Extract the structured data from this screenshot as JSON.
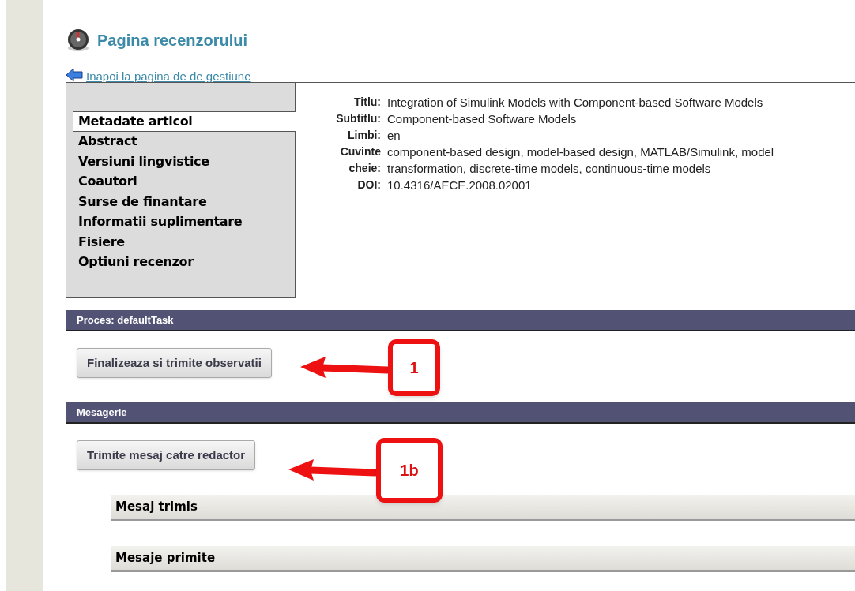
{
  "page_title": "Pagina recenzorului",
  "back_link": "Inapoi la pagina de de gestiune",
  "sidebar": {
    "items": [
      {
        "label": "Metadate articol",
        "selected": true
      },
      {
        "label": "Abstract",
        "selected": false
      },
      {
        "label": "Versiuni lingvistice",
        "selected": false
      },
      {
        "label": "Coautori",
        "selected": false
      },
      {
        "label": "Surse de finantare",
        "selected": false
      },
      {
        "label": "Informatii suplimentare",
        "selected": false
      },
      {
        "label": "Fisiere",
        "selected": false
      },
      {
        "label": "Optiuni recenzor",
        "selected": false
      }
    ]
  },
  "metadata": [
    {
      "label": "Titlu:",
      "value": "Integration of Simulink Models with Component-based Software Models"
    },
    {
      "label": "Subtitlu:",
      "value": "Component-based Software Models"
    },
    {
      "label": "Limbi:",
      "value": "en"
    },
    {
      "label": "Cuvinte cheie:",
      "value": "component-based design, model-based design, MATLAB/Simulink, model transformation, discrete-time models, continuous-time models"
    },
    {
      "label": "DOI:",
      "value": "10.4316/AECE.2008.02001"
    }
  ],
  "sections": [
    {
      "title": "Proces: defaultTask",
      "button": "Finalizeaza si trimite observatii",
      "callout": "1"
    },
    {
      "title": "Mesagerie",
      "button": "Trimite mesaj catre redactor",
      "callout": "1b",
      "panels": [
        "Mesaj trimis",
        "Mesaje primite"
      ]
    }
  ]
}
